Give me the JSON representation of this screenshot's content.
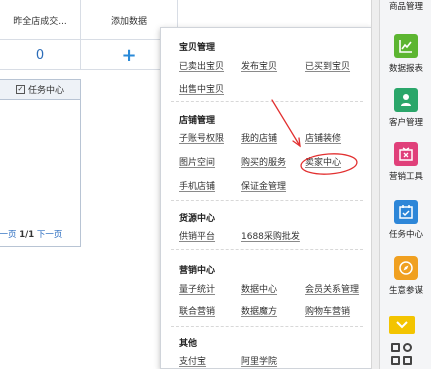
{
  "table": {
    "headers": [
      "昨全店成交...",
      "添加数据"
    ],
    "values": [
      "0",
      "+"
    ]
  },
  "task_panel": {
    "title": "任务中心",
    "checkbox_mark": "✓",
    "pager": {
      "prev": "上一页",
      "current": "1/1",
      "next": "下一页"
    }
  },
  "popup": {
    "sections": [
      {
        "title": "宝贝管理",
        "links": [
          "已卖出宝贝",
          "发布宝贝",
          "已买到宝贝",
          "出售中宝贝"
        ]
      },
      {
        "title": "店铺管理",
        "links": [
          "子账号权限",
          "我的店铺",
          "店铺装修",
          "图片空间",
          "购买的服务",
          "卖家中心",
          "手机店铺",
          "保证金管理"
        ]
      },
      {
        "title": "货源中心",
        "links": [
          "供销平台",
          "1688采购批发"
        ]
      },
      {
        "title": "营销中心",
        "links": [
          "量子统计",
          "数据中心",
          "会员关系管理",
          "联合营销",
          "数据魔方",
          "购物车营销"
        ]
      },
      {
        "title": "其他",
        "links": [
          "支付宝",
          "阿里学院"
        ]
      }
    ],
    "highlighted_link": "卖家中心"
  },
  "sidebar": {
    "top_label": "商品管理",
    "items": [
      {
        "label": "数据报表",
        "icon": "chart-icon",
        "color": "#5cb531"
      },
      {
        "label": "客户管理",
        "icon": "customer-icon",
        "color": "#2aa66a"
      },
      {
        "label": "营销工具",
        "icon": "discount-icon",
        "color": "#e0407a"
      },
      {
        "label": "任务中心",
        "icon": "calendar-check-icon",
        "color": "#2d86d8"
      },
      {
        "label": "生意参谋",
        "icon": "compass-icon",
        "color": "#f0a020"
      }
    ],
    "scroll_icon": "chevron-down-icon",
    "apps_icon": "app-grid-icon"
  },
  "annotation_color": "#e23030"
}
